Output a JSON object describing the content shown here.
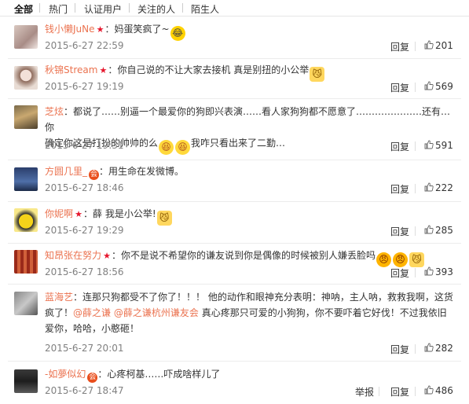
{
  "tabs": [
    "全部",
    "热门",
    "认证用户",
    "关注的人",
    "陌生人"
  ],
  "icons": {
    "star": "red-star-icon",
    "badge": "vip-badge-icon",
    "like": "thumb-up-icon"
  },
  "comments": [
    {
      "name": "钱小懒JuNe",
      "star": "★",
      "text": "妈蛋笑疯了~",
      "time": "2015-6-27 22:59",
      "reply": "回复",
      "likes": "201"
    },
    {
      "name": "秋锦Stream",
      "star": "★",
      "text": "你自己说的不让大家去接机 真是别扭的小公举",
      "time": "2015-6-27 19:19",
      "reply": "回复",
      "likes": "569"
    },
    {
      "name": "芝炫",
      "text1": "都说了……别逼一个最爱你的狗即兴表演……看人家狗狗都不愿意了…………………还有…你",
      "text2": "确定你这是打扮的帅帅的么",
      "text3": "我咋只看出来了二勤…",
      "time": "2015-6-27 19:31",
      "reply": "回复",
      "likes": "591"
    },
    {
      "name": "方圆几里_",
      "badge": "会",
      "text": "用生命在发微博。",
      "time": "2015-6-27 18:46",
      "reply": "回复",
      "likes": "222"
    },
    {
      "name": "你妮啊",
      "star": "★",
      "text": "薛 我是小公举!",
      "time": "2015-6-27 19:29",
      "reply": "回复",
      "likes": "285"
    },
    {
      "name": "知昂张在努力",
      "star": "★",
      "text": "你不是说不希望你的谦友说到你是偶像的时候被别人嫌丢脸吗",
      "time": "2015-6-27 18:56",
      "reply": "回复",
      "likes": "393"
    },
    {
      "name": "蓝海艺",
      "text1": "连那只狗都受不了你了！！！ 他的动作和眼神充分表明：神呐，主人呐，救救我啊，这货",
      "text2a": "疯了！",
      "mention1": "@薛之谦",
      "mention2": "@薛之谦杭州谦友会",
      "text2b": "真心疼那只可爱的小狗狗，你不要吓着它好伐！不过我依旧",
      "text3": "爱你，哈哈，小憨砸！",
      "time": "2015-6-27 20:01",
      "reply": "回复",
      "likes": "282"
    },
    {
      "name": "-如夢似幻",
      "badge": "会",
      "text": "心疼柯基……吓成啥样儿了",
      "time": "2015-6-27 18:47",
      "report": "举报",
      "reply": "回复",
      "likes": "486"
    }
  ]
}
